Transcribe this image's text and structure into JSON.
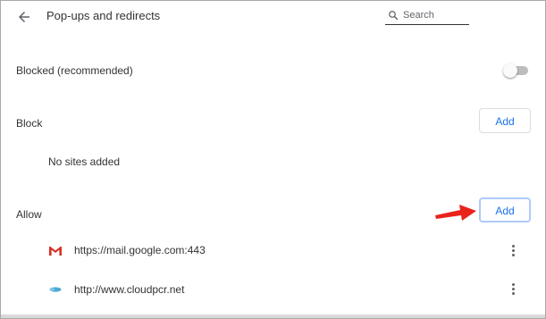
{
  "header": {
    "title": "Pop-ups and redirects",
    "search_placeholder": "Search"
  },
  "blocked_setting": {
    "label": "Blocked (recommended)",
    "toggle_on": false
  },
  "block_section": {
    "heading": "Block",
    "add_label": "Add",
    "empty_text": "No sites added"
  },
  "allow_section": {
    "heading": "Allow",
    "add_label": "Add",
    "sites": [
      {
        "url": "https://mail.google.com:443",
        "favicon": "gmail-icon"
      },
      {
        "url": "http://www.cloudpcr.net",
        "favicon": "cloudpcr-icon"
      }
    ]
  },
  "colors": {
    "accent": "#1a73e8",
    "annotation_arrow": "#e8231c",
    "focus_ring": "#aecbfa"
  },
  "icons": {
    "back": "back-arrow-icon",
    "search": "search-icon",
    "more": "more-vert-icon"
  }
}
